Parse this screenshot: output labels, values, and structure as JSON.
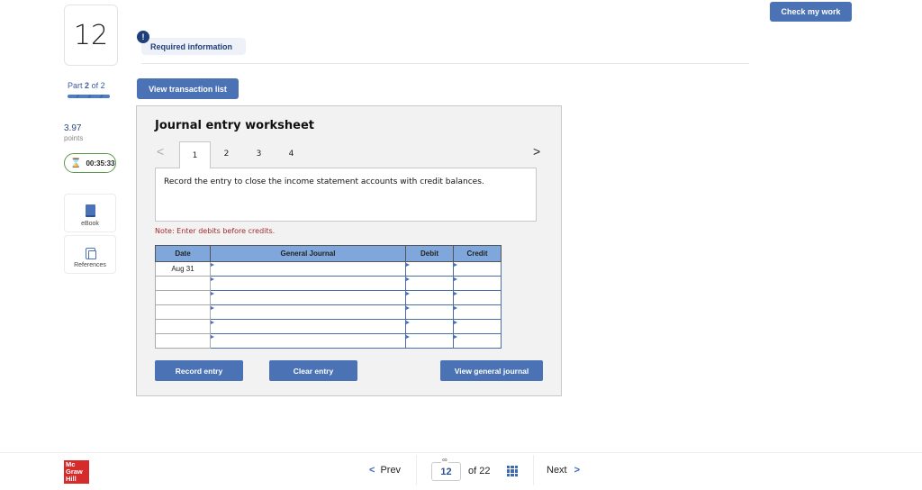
{
  "question": {
    "number": "12",
    "part_label": "Part",
    "part_current": "2",
    "part_of": "of 2",
    "points_value": "3.97",
    "points_label": "points",
    "timer": "00:35:33"
  },
  "rail": {
    "ebook_label": "eBook",
    "references_label": "References"
  },
  "header": {
    "required_badge": "!",
    "required_label": "Required information",
    "check_button": "Check my work",
    "view_transaction_button": "View transaction list"
  },
  "worksheet": {
    "title": "Journal entry worksheet",
    "tabs": [
      "1",
      "2",
      "3",
      "4"
    ],
    "active_tab": "1",
    "prev_arrow": "<",
    "next_arrow": ">",
    "instruction": "Record the entry to close the income statement accounts with credit balances.",
    "note": "Note: Enter debits before credits.",
    "columns": [
      "Date",
      "General Journal",
      "Debit",
      "Credit"
    ],
    "rows": [
      {
        "date": "Aug 31",
        "account": "",
        "debit": "",
        "credit": ""
      },
      {
        "date": "",
        "account": "",
        "debit": "",
        "credit": ""
      },
      {
        "date": "",
        "account": "",
        "debit": "",
        "credit": ""
      },
      {
        "date": "",
        "account": "",
        "debit": "",
        "credit": ""
      },
      {
        "date": "",
        "account": "",
        "debit": "",
        "credit": ""
      },
      {
        "date": "",
        "account": "",
        "debit": "",
        "credit": ""
      }
    ],
    "record_button": "Record entry",
    "clear_button": "Clear entry",
    "view_journal_button": "View general journal"
  },
  "footer": {
    "logo": "Mc Graw Hill",
    "prev_label": "Prev",
    "next_label": "Next",
    "current_page": "12",
    "of_total": "of 22",
    "prev_chevron": "<",
    "next_chevron": ">",
    "link_icon": "∞"
  },
  "colors": {
    "accent": "#4a72b4",
    "table_header": "#7fa7dc",
    "note_red": "#a42a2a",
    "logo_red": "#d52b2b",
    "timer_green": "#5c9a4a"
  }
}
